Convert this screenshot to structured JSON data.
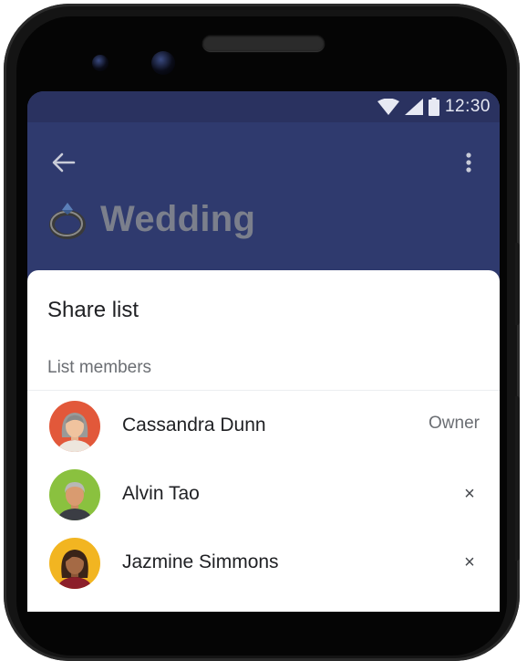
{
  "status_bar": {
    "time": "12:30"
  },
  "list": {
    "title": "Wedding"
  },
  "share_sheet": {
    "title": "Share list",
    "section_label": "List members",
    "members": [
      {
        "name": "Cassandra Dunn",
        "role": "Owner",
        "removable": false,
        "avatar_bg": "#e2583a"
      },
      {
        "name": "Alvin Tao",
        "role": "",
        "removable": true,
        "remove_label": "×",
        "avatar_bg": "#8ac13f"
      },
      {
        "name": "Jazmine Simmons",
        "role": "",
        "removable": true,
        "remove_label": "×",
        "avatar_bg": "#f2b521"
      }
    ]
  },
  "colors": {
    "appbar": "#2f3a6e",
    "status_bar": "#2a3260",
    "sheet": "#ffffff",
    "title_text": "#7b7f8c"
  }
}
